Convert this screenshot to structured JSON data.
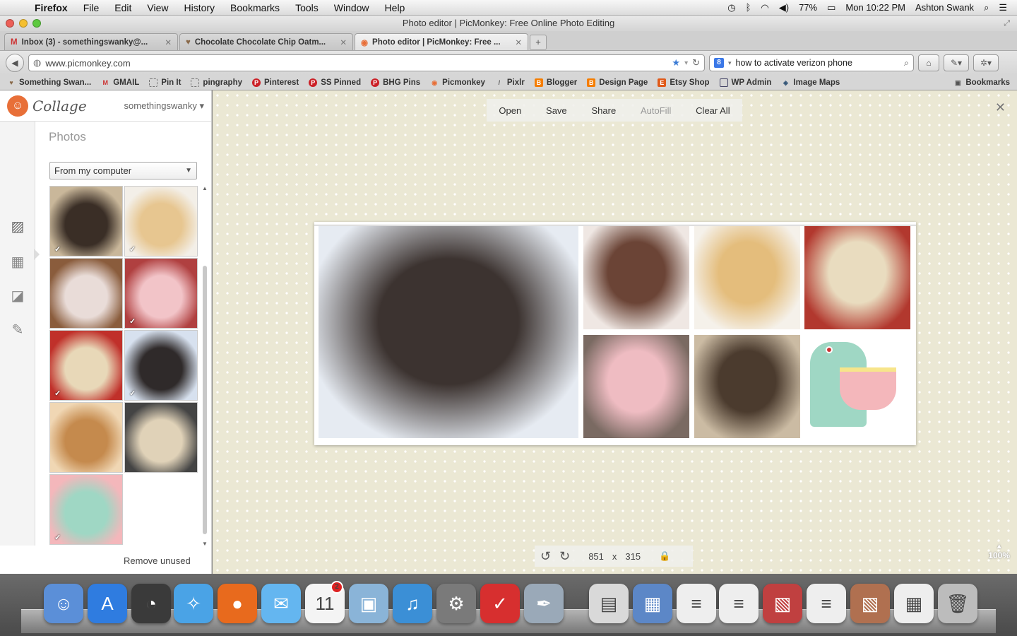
{
  "menubar": {
    "apple_glyph": "",
    "items": [
      "Firefox",
      "File",
      "Edit",
      "View",
      "History",
      "Bookmarks",
      "Tools",
      "Window",
      "Help"
    ],
    "battery": "77%",
    "clock": "Mon 10:22 PM",
    "user": "Ashton Swank"
  },
  "window": {
    "title": "Photo editor | PicMonkey: Free Online Photo Editing"
  },
  "tabs": [
    {
      "label": "Inbox (3) - somethingswanky@...",
      "icon": "gmail-icon"
    },
    {
      "label": "Chocolate Chocolate Chip Oatm...",
      "icon": "heart-icon"
    },
    {
      "label": "Photo editor | PicMonkey: Free ...",
      "icon": "picmonkey-icon"
    }
  ],
  "navbar": {
    "url": "www.picmonkey.com",
    "search_value": "how to activate verizon phone"
  },
  "bookmarks": [
    "Something Swan...",
    "GMAIL",
    "Pin It",
    "pingraphy",
    "Pinterest",
    "SS Pinned",
    "BHG Pins",
    "Picmonkey",
    "Pixlr",
    "Blogger",
    "Design Page",
    "Etsy Shop",
    "WP Admin",
    "Image Maps"
  ],
  "bookmarks_menu": "Bookmarks",
  "sidebar": {
    "app_name": "Collage",
    "account": "somethingswanky",
    "photos_title": "Photos",
    "source": "From my computer",
    "remove_unused": "Remove unused",
    "thumbnails": [
      {
        "name": "chocolate-oats-jar",
        "colors": [
          "#3a2e26",
          "#c9b79a"
        ],
        "checked": true
      },
      {
        "name": "hand-pies",
        "colors": [
          "#e7c690",
          "#f3efe8"
        ],
        "checked": true
      },
      {
        "name": "ice-cream-sundae",
        "colors": [
          "#e9dcd8",
          "#8a5c3c"
        ],
        "checked": false
      },
      {
        "name": "ice-cream-scoop",
        "colors": [
          "#f2c4c8",
          "#b04040"
        ],
        "checked": true
      },
      {
        "name": "popcorn-bowl",
        "colors": [
          "#e8d8b8",
          "#c0302a"
        ],
        "checked": true
      },
      {
        "name": "cookie-on-milk",
        "colors": [
          "#2f2a2a",
          "#d7e1ef"
        ],
        "checked": true
      },
      {
        "name": "pancakes",
        "colors": [
          "#c58a4d",
          "#f0d7b4"
        ],
        "checked": false
      },
      {
        "name": "popcorn-polka-dot",
        "colors": [
          "#e0d2b8",
          "#444444"
        ],
        "checked": false
      },
      {
        "name": "mixer-illustration",
        "colors": [
          "#9fd7c4",
          "#f4b7bb"
        ],
        "checked": true
      }
    ]
  },
  "toolbar": {
    "open": "Open",
    "save": "Save",
    "share": "Share",
    "autofill": "AutoFill",
    "clear": "Clear All"
  },
  "collage_cells": [
    {
      "name": "cookie-on-milk",
      "colors": [
        "#3c3330",
        "#e6ebf2"
      ]
    },
    {
      "name": "chocolate-cookie",
      "colors": [
        "#6b4436",
        "#efe7e3"
      ]
    },
    {
      "name": "hand-pies",
      "colors": [
        "#e4bd7c",
        "#f5f1ea"
      ]
    },
    {
      "name": "popcorn-bowl",
      "colors": [
        "#e9dcbf",
        "#b2382e"
      ]
    },
    {
      "name": "ice-cream-scoop",
      "colors": [
        "#efbcc2",
        "#7a6a62"
      ]
    },
    {
      "name": "chocolate-oats-jar",
      "colors": [
        "#4b3b2e",
        "#cbbba3"
      ]
    },
    {
      "name": "mixer-illustration",
      "colors": [
        "#9fd7c4",
        "#f4b7bb"
      ]
    }
  ],
  "dimensions": {
    "width": "851",
    "times": "x",
    "height": "315"
  },
  "zoom": "100%",
  "dock": [
    {
      "name": "finder-icon",
      "color": "#5b8fd8",
      "glyph": "☺"
    },
    {
      "name": "app-store-icon",
      "color": "#2f7ce0",
      "glyph": "A"
    },
    {
      "name": "dashboard-icon",
      "color": "#3a3a3a",
      "glyph": "◔"
    },
    {
      "name": "safari-icon",
      "color": "#4aa3e6",
      "glyph": "✧"
    },
    {
      "name": "firefox-icon",
      "color": "#e86a1d",
      "glyph": "●"
    },
    {
      "name": "messages-icon",
      "color": "#64b6f0",
      "glyph": "✉"
    },
    {
      "name": "calendar-icon",
      "color": "#f4f4f4",
      "glyph": "11",
      "badge": "2"
    },
    {
      "name": "iphoto-icon",
      "color": "#8ab4d8",
      "glyph": "▣"
    },
    {
      "name": "itunes-icon",
      "color": "#3b8fd6",
      "glyph": "♫"
    },
    {
      "name": "system-preferences-icon",
      "color": "#7a7a7a",
      "glyph": "⚙"
    },
    {
      "name": "wunderlist-icon",
      "color": "#d72f2f",
      "glyph": "✓"
    },
    {
      "name": "preview-icon",
      "color": "#9aa9b8",
      "glyph": "✒"
    },
    {
      "name": "downloads-icon",
      "color": "#d9d9d9",
      "glyph": "▤"
    },
    {
      "name": "documents-stack-icon",
      "color": "#5c87c7",
      "glyph": "▦"
    },
    {
      "name": "document-1-icon",
      "color": "#eeeeee",
      "glyph": "≡"
    },
    {
      "name": "document-2-icon",
      "color": "#eeeeee",
      "glyph": "≡"
    },
    {
      "name": "photo-stack-icon",
      "color": "#c04040",
      "glyph": "▧"
    },
    {
      "name": "document-3-icon",
      "color": "#eeeeee",
      "glyph": "≡"
    },
    {
      "name": "recipe-photo-icon",
      "color": "#b07050",
      "glyph": "▧"
    },
    {
      "name": "screenshot-icon",
      "color": "#eeeeee",
      "glyph": "▦"
    },
    {
      "name": "trash-icon",
      "color": "#bcbcbc",
      "glyph": "🗑"
    }
  ]
}
